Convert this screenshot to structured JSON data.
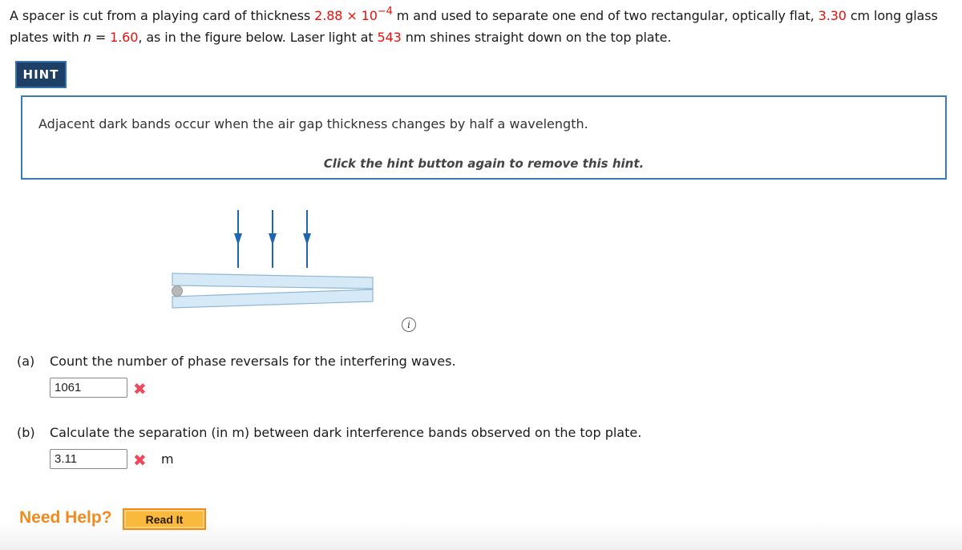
{
  "problem": {
    "text_1": "A spacer is cut from a playing card of thickness ",
    "thickness_mantissa": "2.88",
    "times": " × 10",
    "thickness_exponent": "−4",
    "text_2": " m and used to separate one end of two rectangular, optically flat, ",
    "length": "3.30",
    "text_3": " cm long glass plates with ",
    "n_symbol": "n",
    "equals": " = ",
    "index": "1.60",
    "text_4": ", as in the figure below. Laser light at ",
    "wavelength": "543",
    "text_5": " nm shines straight down on the top plate."
  },
  "hint": {
    "button_label": "HINT",
    "text": "Adjacent dark bands occur when the air gap thickness changes by half a wavelength.",
    "remove_text": "Click the hint button again to remove this hint."
  },
  "figure": {
    "arrow_count": 3,
    "colors": {
      "arrow": "#1f66b0",
      "plate_fill": "#d6e9f6",
      "plate_stroke": "#8fb8d4",
      "spacer": "#b8b8b8"
    }
  },
  "info_icon": "i",
  "parts": [
    {
      "letter": "(a)",
      "question": "Count the number of phase reversals for the interfering waves.",
      "answer": "1061",
      "status": "incorrect",
      "status_icon": "✖",
      "unit": ""
    },
    {
      "letter": "(b)",
      "question": "Calculate the separation (in m) between dark interference bands observed on the top plate.",
      "answer": "3.11",
      "status": "incorrect",
      "status_icon": "✖",
      "unit": "m"
    }
  ],
  "help": {
    "label": "Need Help?",
    "read_it_label": "Read It"
  }
}
